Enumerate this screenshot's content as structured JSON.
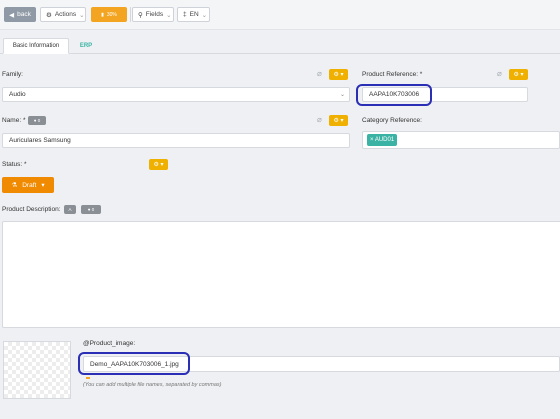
{
  "toolbar": {
    "back_label": "back",
    "actions_label": "Actions",
    "progress_label": "30%",
    "progress_value": 0.3,
    "fields_label": "Fields",
    "lang_label": "EN"
  },
  "tabs": [
    "Basic Information",
    "ERP"
  ],
  "form": {
    "family_label": "Family:",
    "family_value": "Audio",
    "product_ref_label": "Product Reference: *",
    "product_ref_value": "AAPA10K703006",
    "name_label": "Name: *",
    "name_value": "Auriculares Samsung",
    "name_tag": "0",
    "category_ref_label": "Category Reference:",
    "category_chip": "× AUD01",
    "status_label": "Status: *",
    "status_value": "Draft",
    "description_label": "Product Description:",
    "description_tag": "0",
    "description_value": "",
    "image_label": "@Product_image:",
    "image_value": "Demo_AAPA10K703006_1.jpg",
    "image_hint": "(You can add multiple file names, separated by commas)"
  },
  "colors": {
    "accent_orange": "#f3a521",
    "draft_orange": "#f08a00",
    "gear_yellow": "#f0b000",
    "teal": "#3bb3a4",
    "highlight_blue": "#2a2fb5"
  },
  "icons": {
    "back": "arrow-left-icon",
    "actions": "cog-icon",
    "progress": "gauge-icon",
    "fields": "filter-icon",
    "lang": "globe-icon",
    "attach": "paperclip-icon",
    "status": "flask-icon"
  }
}
